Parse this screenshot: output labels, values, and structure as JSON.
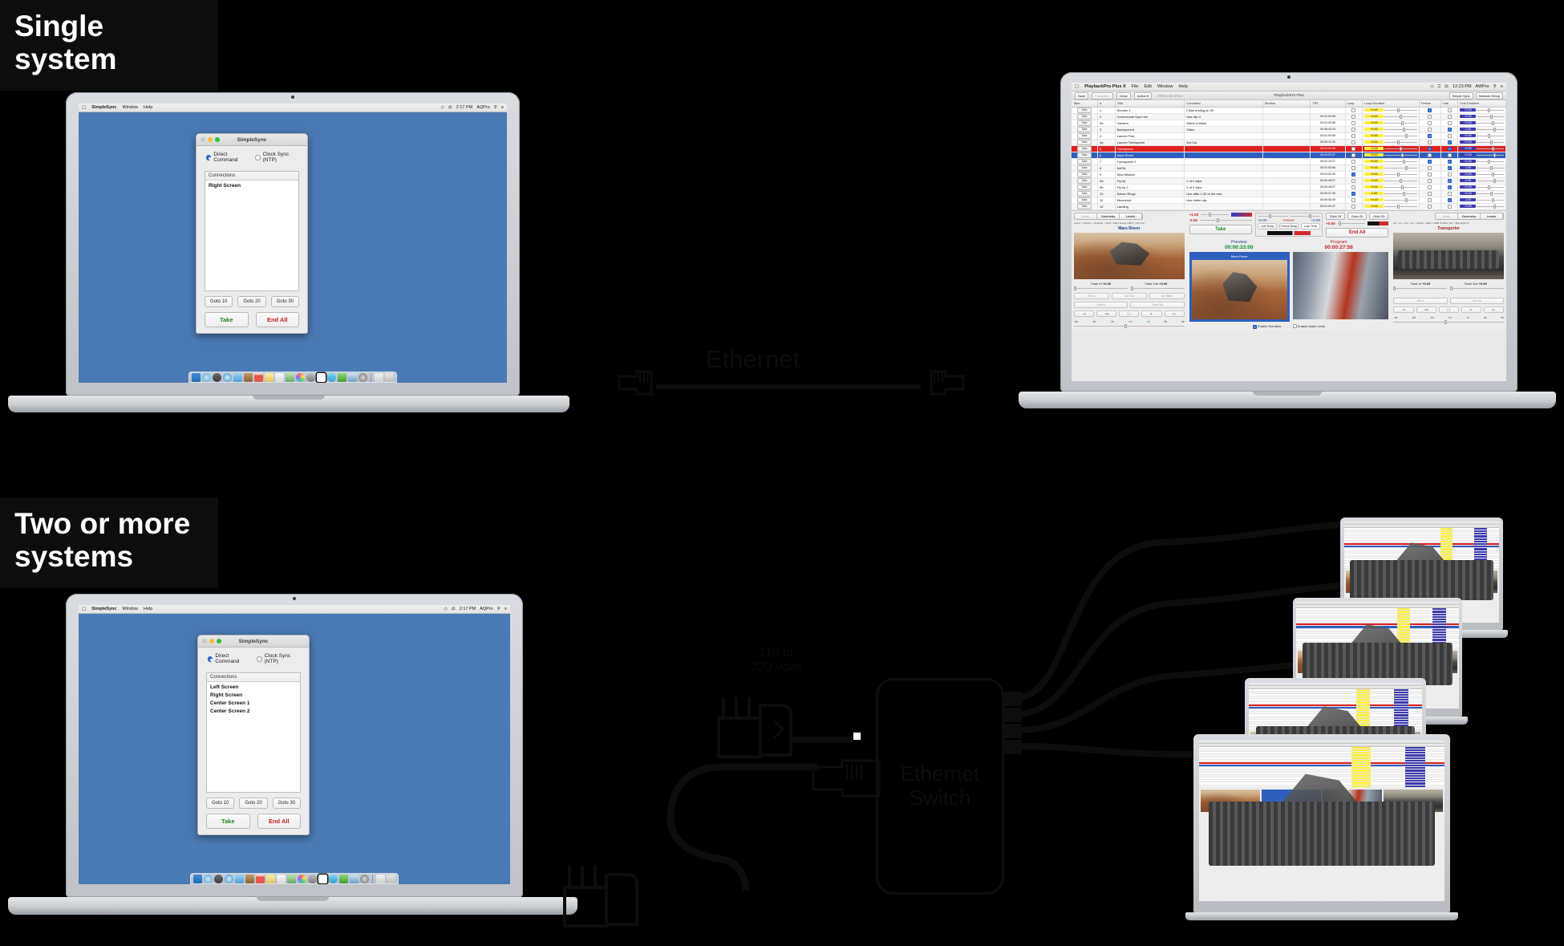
{
  "labels": {
    "single": "Single\nsystem",
    "single_line1": "Single",
    "single_line2": "system",
    "multi_line1": "Two or more",
    "multi_line2": "systems"
  },
  "diagram": {
    "ethernet_label": "Ethernet",
    "volts_line1": "110 or",
    "volts_line2": "220 volts",
    "switch_line1": "Ethernet",
    "switch_line2": "Switch"
  },
  "simplesync": {
    "menubar": {
      "apple": "apple-icon",
      "app": "SimpleSync",
      "items": [
        "Window",
        "Help"
      ],
      "status_icons": [
        "wifi-icon",
        "bluetooth-icon"
      ],
      "time": "2:17 PM",
      "user": "AQPro",
      "search": "search-icon",
      "list": "list-icon"
    },
    "window_title": "SimpleSync",
    "radios": [
      {
        "label": "Direct Command",
        "selected": true
      },
      {
        "label": "Clock Sync (NTP)",
        "selected": false
      }
    ],
    "list_header": "Connections",
    "connections_single": [
      "Right Screen"
    ],
    "connections_multi": [
      "Left Screen",
      "Right Screen",
      "Center Screen 1",
      "Center Screen 2"
    ],
    "goto_buttons": [
      "Goto 10",
      "Goto 20",
      "Goto 30"
    ],
    "take_label": "Take",
    "endall_label": "End All",
    "take_color": "#1a8a1f",
    "endall_color": "#c42020"
  },
  "playbackpro": {
    "menubar": {
      "app": "PlaybackPro Plus X",
      "items": [
        "File",
        "Edit",
        "Window",
        "Help"
      ],
      "time": "12:23 PM",
      "user": "AWPro"
    },
    "toolbar": {
      "save": "Save",
      "fullscreen": "Fullscreen",
      "close": "Close",
      "action": "Action",
      "document": "Afternoon show",
      "window_title": "PlaybackPro Plus",
      "simple_sync": "Simple Sync",
      "network_setup": "Network Setup"
    },
    "columns": [
      "Take",
      "#",
      "Title",
      "Comment",
      "Section",
      "TRT",
      "Loop",
      "Loop Duration",
      "Freeze",
      "Link",
      "Link Duration"
    ],
    "take_cell_label": "Take",
    "rows": [
      {
        "num": "1",
        "title": "Sunrise 1",
        "comment": "False ending at :20",
        "section": "",
        "trt": "",
        "loop": false,
        "loop_dur": "+0.00",
        "freeze": true,
        "link": false,
        "link_dur": "+0.00",
        "state": ""
      },
      {
        "num": "2",
        "title": "Commercial Spot reel",
        "comment": "Use clip 4",
        "section": "",
        "trt": "00:01:00:56",
        "loop": false,
        "loop_dur": "+0.00",
        "freeze": false,
        "link": false,
        "link_dur": "+0.00",
        "state": ""
      },
      {
        "num": "3a",
        "title": "Volcano",
        "comment": "Starts in black",
        "section": "",
        "trt": "00:01:00:56",
        "loop": false,
        "loop_dur": "+0.00",
        "freeze": false,
        "link": false,
        "link_dur": "+0.00",
        "state": ""
      },
      {
        "num": "3",
        "title": "Background",
        "comment": "Cities",
        "section": "",
        "trt": "00:36:42:24",
        "loop": false,
        "loop_dur": "+0.00",
        "freeze": false,
        "link": true,
        "link_dur": "-1.00",
        "state": ""
      },
      {
        "num": "4",
        "title": "Launch Pad",
        "comment": "",
        "section": "",
        "trt": "00:01:00:56",
        "loop": false,
        "loop_dur": "+0.00",
        "freeze": true,
        "link": false,
        "link_dur": "+0.00",
        "state": ""
      },
      {
        "num": "4a",
        "title": "Launch Transporter",
        "comment": "3rd Cut",
        "section": "",
        "trt": "00:00:12:30",
        "loop": false,
        "loop_dur": "+0.00",
        "freeze": false,
        "link": true,
        "link_dur": "+0.00",
        "state": ""
      },
      {
        "num": "5",
        "title": "Transporter",
        "comment": "",
        "section": "",
        "trt": "00:01:00:55",
        "loop": false,
        "loop_dur": "+0.00",
        "freeze": true,
        "link": true,
        "link_dur": "+0.00",
        "state": "red"
      },
      {
        "num": "6",
        "title": "Mars Rover",
        "comment": "",
        "section": "",
        "trt": "00:04:52:57",
        "loop": false,
        "loop_dur": "+0.00",
        "freeze": false,
        "link": false,
        "link_dur": "+0.00",
        "state": "blue"
      },
      {
        "num": "7",
        "title": "Transporter 2",
        "comment": "",
        "section": "",
        "trt": "00:02:19:27",
        "loop": false,
        "loop_dur": "+0.00",
        "freeze": true,
        "link": true,
        "link_dur": "+0.00",
        "state": ""
      },
      {
        "num": "8",
        "title": "NASA",
        "comment": "",
        "section": "",
        "trt": "00:01:00:56",
        "loop": false,
        "loop_dur": "+0.00",
        "freeze": false,
        "link": true,
        "link_dur": "-1.50",
        "state": ""
      },
      {
        "num": "9",
        "title": "New Mission",
        "comment": "",
        "section": "",
        "trt": "00:03:02:40",
        "loop": true,
        "loop_dur": "+0.00",
        "freeze": false,
        "link": false,
        "link_dur": "+0.00",
        "state": ""
      },
      {
        "num": "9a",
        "title": "Fly by",
        "comment": "1 of 2 clips",
        "section": "",
        "trt": "00:00:49:07",
        "loop": false,
        "loop_dur": "+0.00",
        "freeze": false,
        "link": true,
        "link_dur": "-2.00",
        "state": ""
      },
      {
        "num": "9b",
        "title": "Fly by 2",
        "comment": "2 of 2 clips",
        "section": "",
        "trt": "00:00:49:07",
        "loop": false,
        "loop_dur": "+0.00",
        "freeze": false,
        "link": true,
        "link_dur": "+0.00",
        "state": ""
      },
      {
        "num": "10",
        "title": "Saturn Rings",
        "comment": "Use after 1:30 to the end",
        "section": "",
        "trt": "00:00:37:49",
        "loop": true,
        "loop_dur": "-2.60",
        "freeze": false,
        "link": false,
        "link_dur": "+0.00",
        "state": ""
      },
      {
        "num": "11",
        "title": "Moonshot",
        "comment": "Use entire clip",
        "section": "",
        "trt": "00:09:55:49",
        "loop": false,
        "loop_dur": "+0.00",
        "freeze": false,
        "link": true,
        "link_dur": "-2.00",
        "state": ""
      },
      {
        "num": "12",
        "title": "Landing",
        "comment": "",
        "section": "",
        "trt": "00:01:00:47",
        "loop": false,
        "loop_dur": "+0.00",
        "freeze": false,
        "link": false,
        "link_dur": "+0.00",
        "state": ""
      }
    ],
    "left_panel": {
      "tabs": [
        "Main",
        "Geometry",
        "Levels"
      ],
      "path": "Users > kitchen > Desktop > AAA > Mars Rover 1280 x 720.mov",
      "clip": "Mars Rover",
      "fade_in_label": "Fade In",
      "fade_in_value": "+0.00",
      "fade_out_label": "Fade Out",
      "fade_out_value": "+0.00",
      "set_buttons": [
        "Set In",
        "Set Out",
        "Set State"
      ],
      "goto_buttons": [
        "Goto In",
        "Goto Out"
      ],
      "speeds": [
        "-4x",
        "-2x",
        "-1x",
        "<I>",
        "1x",
        "2x",
        "4x"
      ]
    },
    "right_panel": {
      "tabs": [
        "Main",
        "Geometry",
        "Levels"
      ],
      "path": "01 > A1 > D1 > A1 > NASA - 1920 x 1080 ProRes 422 - 060-Apple Pr",
      "clip": "Transporter",
      "fade_in_label": "Fade In",
      "fade_in_value": "+0.00",
      "fade_out_label": "Fade Out",
      "fade_out_value": "+0.00",
      "set_buttons": [
        "Set In",
        "Set Out"
      ],
      "speeds": [
        "-4x",
        "-2x",
        "-1x",
        "<I>",
        "1x",
        "2x",
        "4x"
      ]
    },
    "center_panel": {
      "val_plus": "+1.50",
      "val_minus": "-2.50",
      "take_label": "Take",
      "link_temp_value": "+0.00",
      "freeze_label": "Freeze",
      "freeze_temp_value": "+0.00",
      "buttons": [
        "Link Temp",
        "Freeze Temp",
        "Loop Temp"
      ],
      "goto_buttons": [
        "Goto 10",
        "Goto 20",
        "Goto 30"
      ],
      "endall_value": "+0.50",
      "endall_label": "End All",
      "preview_label": "Preview",
      "program_label": "Program",
      "preview_tc": "00:00:33:00",
      "program_tc": "00:00:27:56",
      "preview_clip": "Mars Rover",
      "enable_scrubber": "Enable Scrubber",
      "enable_audio": "Enable Audio Level",
      "scrubber_checked": true,
      "audio_checked": false
    }
  },
  "colors": {
    "desktop_blue": "#4a7ab5",
    "sel_red": "#e02020",
    "sel_blue": "#2f5fbe",
    "yellow": "#ffef3f",
    "indigo": "#3b3bb0",
    "green_text": "#1a8a1f",
    "red_text": "#c42020"
  }
}
